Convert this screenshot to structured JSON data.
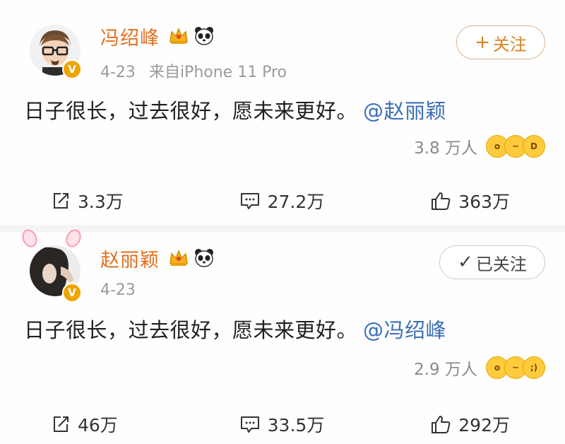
{
  "posts": [
    {
      "user": {
        "name": "冯绍峰",
        "verified_mark": "V",
        "badges": [
          "crown-badge-icon",
          "panda-badge-icon"
        ]
      },
      "date": "4-23",
      "source": "来自iPhone 11 Pro",
      "follow_button": {
        "icon": "+",
        "label": "关注"
      },
      "text": "日子很长，过去很好，愿未来更好。",
      "mention": "@赵丽颖",
      "reactions": {
        "count": "3.8 万人",
        "emojis": [
          "surprised-emoji-icon",
          "smirk-emoji-icon",
          "laugh-emoji-icon"
        ]
      },
      "actions": {
        "repost": "3.3万",
        "comment": "27.2万",
        "like": "363万"
      }
    },
    {
      "user": {
        "name": "赵丽颖",
        "verified_mark": "V",
        "badges": [
          "crown-badge-icon",
          "panda-badge-icon"
        ]
      },
      "date": "4-23",
      "follow_button": {
        "icon": "✓",
        "label": "已关注"
      },
      "text": "日子很长，过去很好，愿未来更好。",
      "mention": "@冯绍峰",
      "reactions": {
        "count": "2.9 万人",
        "emojis": [
          "surprised-emoji-icon",
          "smirk-emoji-icon",
          "wink-emoji-icon"
        ]
      },
      "actions": {
        "repost": "46万",
        "comment": "33.5万",
        "like": "292万"
      }
    }
  ],
  "colors": {
    "name": "#e36e1c",
    "mention": "#3b6fb6",
    "verified": "#f0a400",
    "meta": "#9a9a9a"
  }
}
